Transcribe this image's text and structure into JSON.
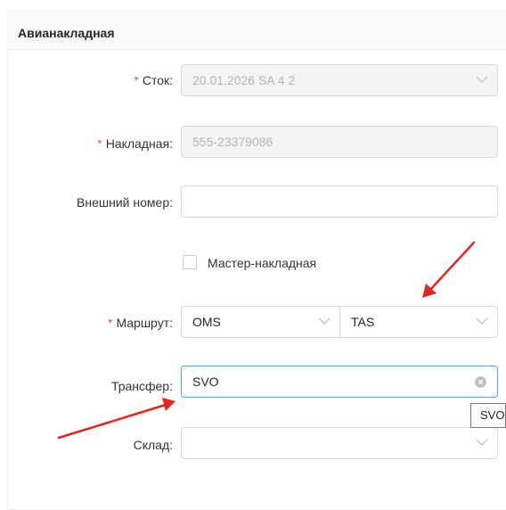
{
  "card": {
    "title": "Авианакладная"
  },
  "form": {
    "required_mark": "*",
    "stock": {
      "label": "Сток:",
      "value": "20.01.2026 SA 4 2"
    },
    "waybill": {
      "label": "Накладная:",
      "value": "555-23379086"
    },
    "external_number": {
      "label": "Внешний номер:",
      "value": ""
    },
    "master_waybill": {
      "label": "Мастер-накладная",
      "checked": false
    },
    "route": {
      "label": "Маршрут:",
      "from": "OMS",
      "to": "TAS"
    },
    "transfer": {
      "label": "Трансфер:",
      "value": "SVO"
    },
    "warehouse": {
      "label": "Склад:",
      "value": ""
    }
  },
  "tooltip": {
    "text": "SVO"
  },
  "colors": {
    "required": "#ff4d4f",
    "focus_border": "#40a9ff",
    "annotation_arrow": "#e8231c"
  },
  "icons": [
    "chevron-down-icon",
    "clear-circle-icon",
    "annotation-arrow"
  ]
}
